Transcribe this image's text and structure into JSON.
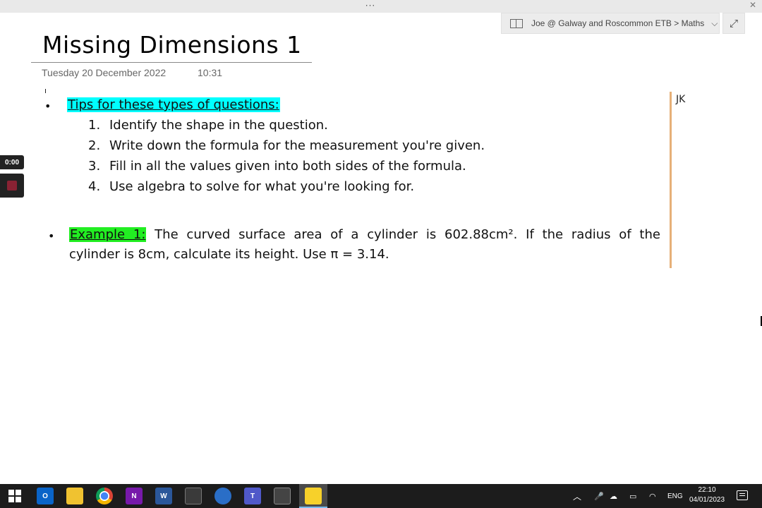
{
  "window": {
    "more_dots": "···",
    "close_glyph": "✕"
  },
  "notebook_nav": {
    "breadcrumb": "Joe @ Galway and Roscommon ETB > Maths",
    "chevron_glyph": "⌵"
  },
  "expand_glyph": "⤢",
  "page": {
    "title": "Missing Dimensions 1",
    "date": "Tuesday 20 December 2022",
    "time": "10:31"
  },
  "recorder": {
    "elapsed": "0:00"
  },
  "note": {
    "bullet_glyph": "•",
    "tips_heading": "Tips for these types of questions:",
    "steps": [
      {
        "num": "1.",
        "text": "Identify the shape in the question."
      },
      {
        "num": "2.",
        "text": "Write down the formula for the measurement you're given."
      },
      {
        "num": "3.",
        "text": "Fill in all the values given into both sides of the formula."
      },
      {
        "num": "4.",
        "text": "Use algebra to solve for what you're looking for."
      }
    ],
    "example": {
      "label": "Example 1:",
      "line1": "The curved surface area of a cylinder is 602.88cm². If the radius of the",
      "line2": "cylinder is 8cm, calculate its height. Use π = 3.14."
    },
    "highlight_tips": "#00ffff",
    "highlight_example": "#22ee22",
    "author_initials": "JK",
    "author_bar_color": "#e6b078"
  },
  "taskbar": {
    "apps": [
      "windows-start",
      "outlook",
      "file-explorer",
      "chrome",
      "onenote",
      "word",
      "calculator",
      "edge",
      "teams",
      "phone-link",
      "sticky-notes"
    ],
    "outlook_letter": "O",
    "onenote_letter": "N",
    "word_letter": "W",
    "teams_letter": "T",
    "tray_up": "︿",
    "language": "ENG",
    "clock_time": "22:10",
    "clock_date": "04/01/2023"
  }
}
